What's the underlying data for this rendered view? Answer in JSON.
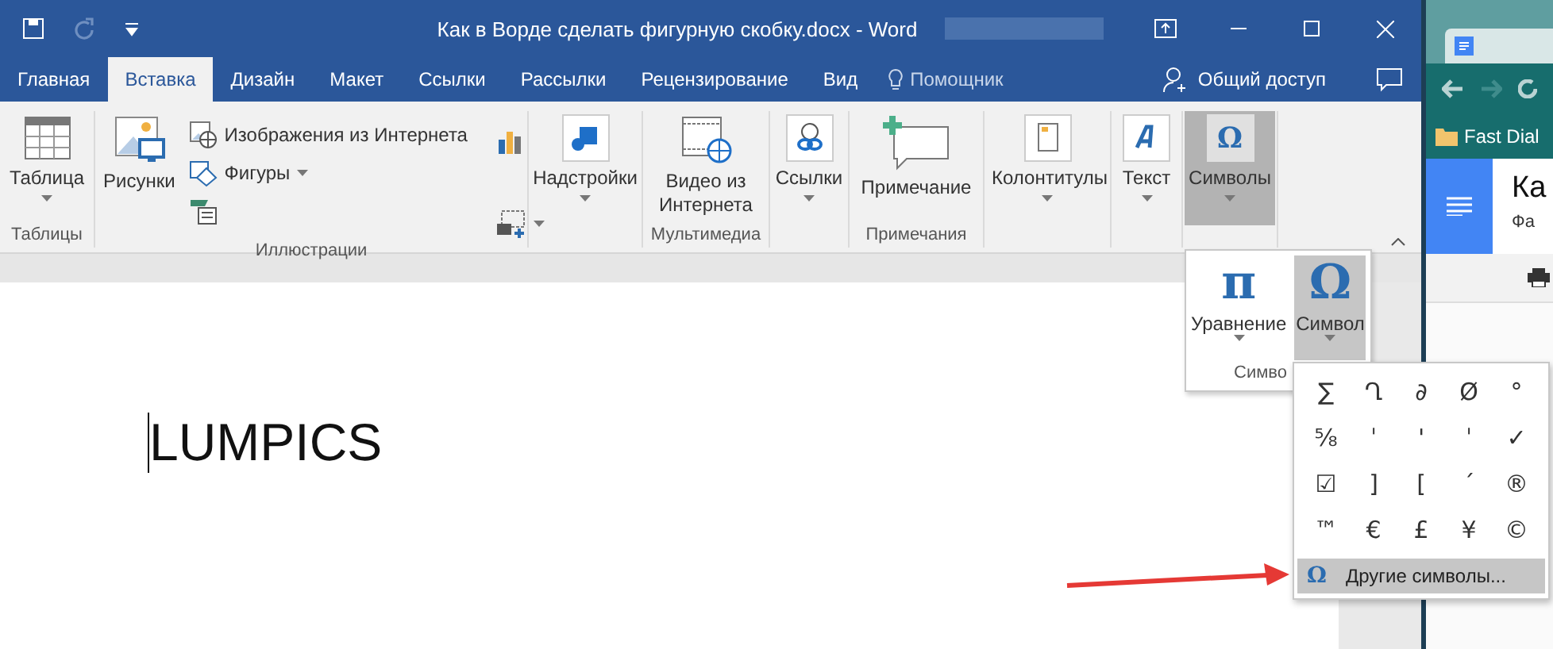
{
  "window": {
    "title": "Как в Ворде сделать фигурную скобку.docx - Word"
  },
  "tabs": [
    {
      "label": "Главная",
      "selected": false
    },
    {
      "label": "Вставка",
      "selected": true
    },
    {
      "label": "Дизайн",
      "selected": false
    },
    {
      "label": "Макет",
      "selected": false
    },
    {
      "label": "Ссылки",
      "selected": false
    },
    {
      "label": "Рассылки",
      "selected": false
    },
    {
      "label": "Рецензирование",
      "selected": false
    },
    {
      "label": "Вид",
      "selected": false
    }
  ],
  "tell_me": "Помощник",
  "share": "Общий доступ",
  "ribbon": {
    "groups": [
      {
        "label": "Таблицы",
        "items": [
          {
            "kind": "large",
            "label": "Таблица",
            "dropdown": true,
            "pressed": false
          }
        ]
      },
      {
        "label": "Иллюстрации",
        "items": [
          {
            "kind": "large",
            "label": "Рисунки",
            "dropdown": false,
            "pressed": false
          },
          {
            "kind": "small",
            "label": "Изображения из Интернета",
            "dropdown": false
          },
          {
            "kind": "small",
            "label": "Фигуры",
            "dropdown": true
          },
          {
            "kind": "small",
            "dropdown": false
          },
          {
            "kind": "icon",
            "dropdown": false
          },
          {
            "kind": "icon",
            "dropdown": true
          }
        ]
      },
      {
        "items": [
          {
            "kind": "large",
            "label": "Надстройки",
            "dropdown": true,
            "pressed": false
          }
        ]
      },
      {
        "label": "Мультимедиа",
        "items": [
          {
            "kind": "large",
            "label": "Видео из Интернета",
            "dropdown": false,
            "pressed": false
          }
        ]
      },
      {
        "items": [
          {
            "kind": "large",
            "label": "Ссылки",
            "dropdown": true,
            "pressed": false
          }
        ]
      },
      {
        "label": "Примечания",
        "items": [
          {
            "kind": "large",
            "label": "Примечание",
            "dropdown": false,
            "pressed": false
          }
        ]
      },
      {
        "items": [
          {
            "kind": "large",
            "label": "Колонтитулы",
            "dropdown": true,
            "pressed": false
          }
        ]
      },
      {
        "items": [
          {
            "kind": "large",
            "label": "Текст",
            "dropdown": true,
            "pressed": false
          }
        ]
      },
      {
        "items": [
          {
            "kind": "large",
            "label": "Символы",
            "dropdown": true,
            "pressed": true,
            "glyph": "Ω"
          }
        ]
      }
    ]
  },
  "symbols_panel": {
    "buttons": [
      {
        "glyph": "π",
        "label": "Уравнение",
        "pressed": false
      },
      {
        "glyph": "Ω",
        "label": "Символ",
        "pressed": true
      }
    ],
    "group_label": "Симво"
  },
  "symbol_menu": {
    "symbols": [
      "∑",
      "Ղ",
      "∂",
      "Ø",
      "°",
      "⅝",
      "ˈ",
      "'",
      "ˈ",
      "✓",
      "☑",
      "]",
      "[",
      "´",
      "®",
      "™",
      "€",
      "£",
      "¥",
      "©"
    ],
    "more": {
      "glyph": "Ω",
      "label": "Другие символы...",
      "selected": true
    }
  },
  "document": {
    "text": "LUMPICS"
  },
  "browser": {
    "bookmark": "Fast Dial",
    "heading": "Ка",
    "subheading": "Фа"
  }
}
